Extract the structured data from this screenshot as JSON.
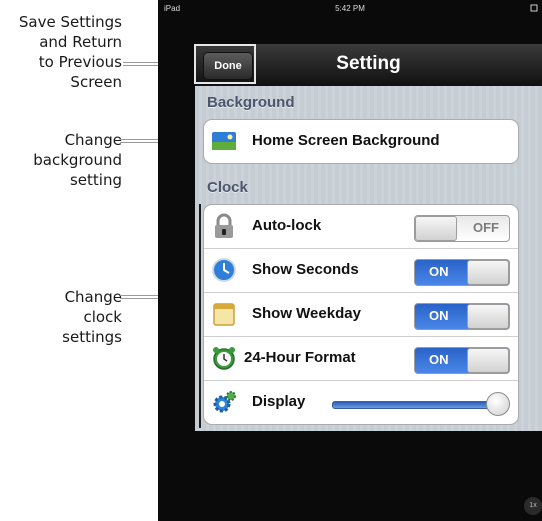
{
  "callouts": {
    "save": [
      "Save Settings",
      "and Return",
      "to Previous",
      "Screen"
    ],
    "background": [
      "Change",
      "background",
      "setting"
    ],
    "clock": [
      "Change",
      "clock",
      "settings"
    ]
  },
  "status_bar": {
    "carrier": "iPad",
    "time": "5:42 PM"
  },
  "navbar": {
    "done_label": "Done",
    "title": "Setting"
  },
  "sections": {
    "background": {
      "header": "Background",
      "item_label": "Home Screen Background",
      "item_icon": "landscape-picture-icon"
    },
    "clock": {
      "header": "Clock",
      "rows": [
        {
          "label": "Auto-lock",
          "icon": "padlock-icon",
          "switch_text": "OFF",
          "state": "off"
        },
        {
          "label": "Show Seconds",
          "icon": "clock-icon",
          "switch_text": "ON",
          "state": "on"
        },
        {
          "label": "Show Weekday",
          "icon": "calendar-icon",
          "switch_text": "ON",
          "state": "on"
        },
        {
          "label": "24-Hour Format",
          "icon": "alarm-clock-icon",
          "switch_text": "ON",
          "state": "on"
        },
        {
          "label": "Display",
          "icon": "gear-icon",
          "slider_value": 1.0
        }
      ]
    }
  },
  "corner_button": "1x",
  "colors": {
    "on_switch": "#2a63c8",
    "nav_bar": "#1e1e1e",
    "panel_bg": "#c5ccd4",
    "section_text": "#4c566c"
  }
}
